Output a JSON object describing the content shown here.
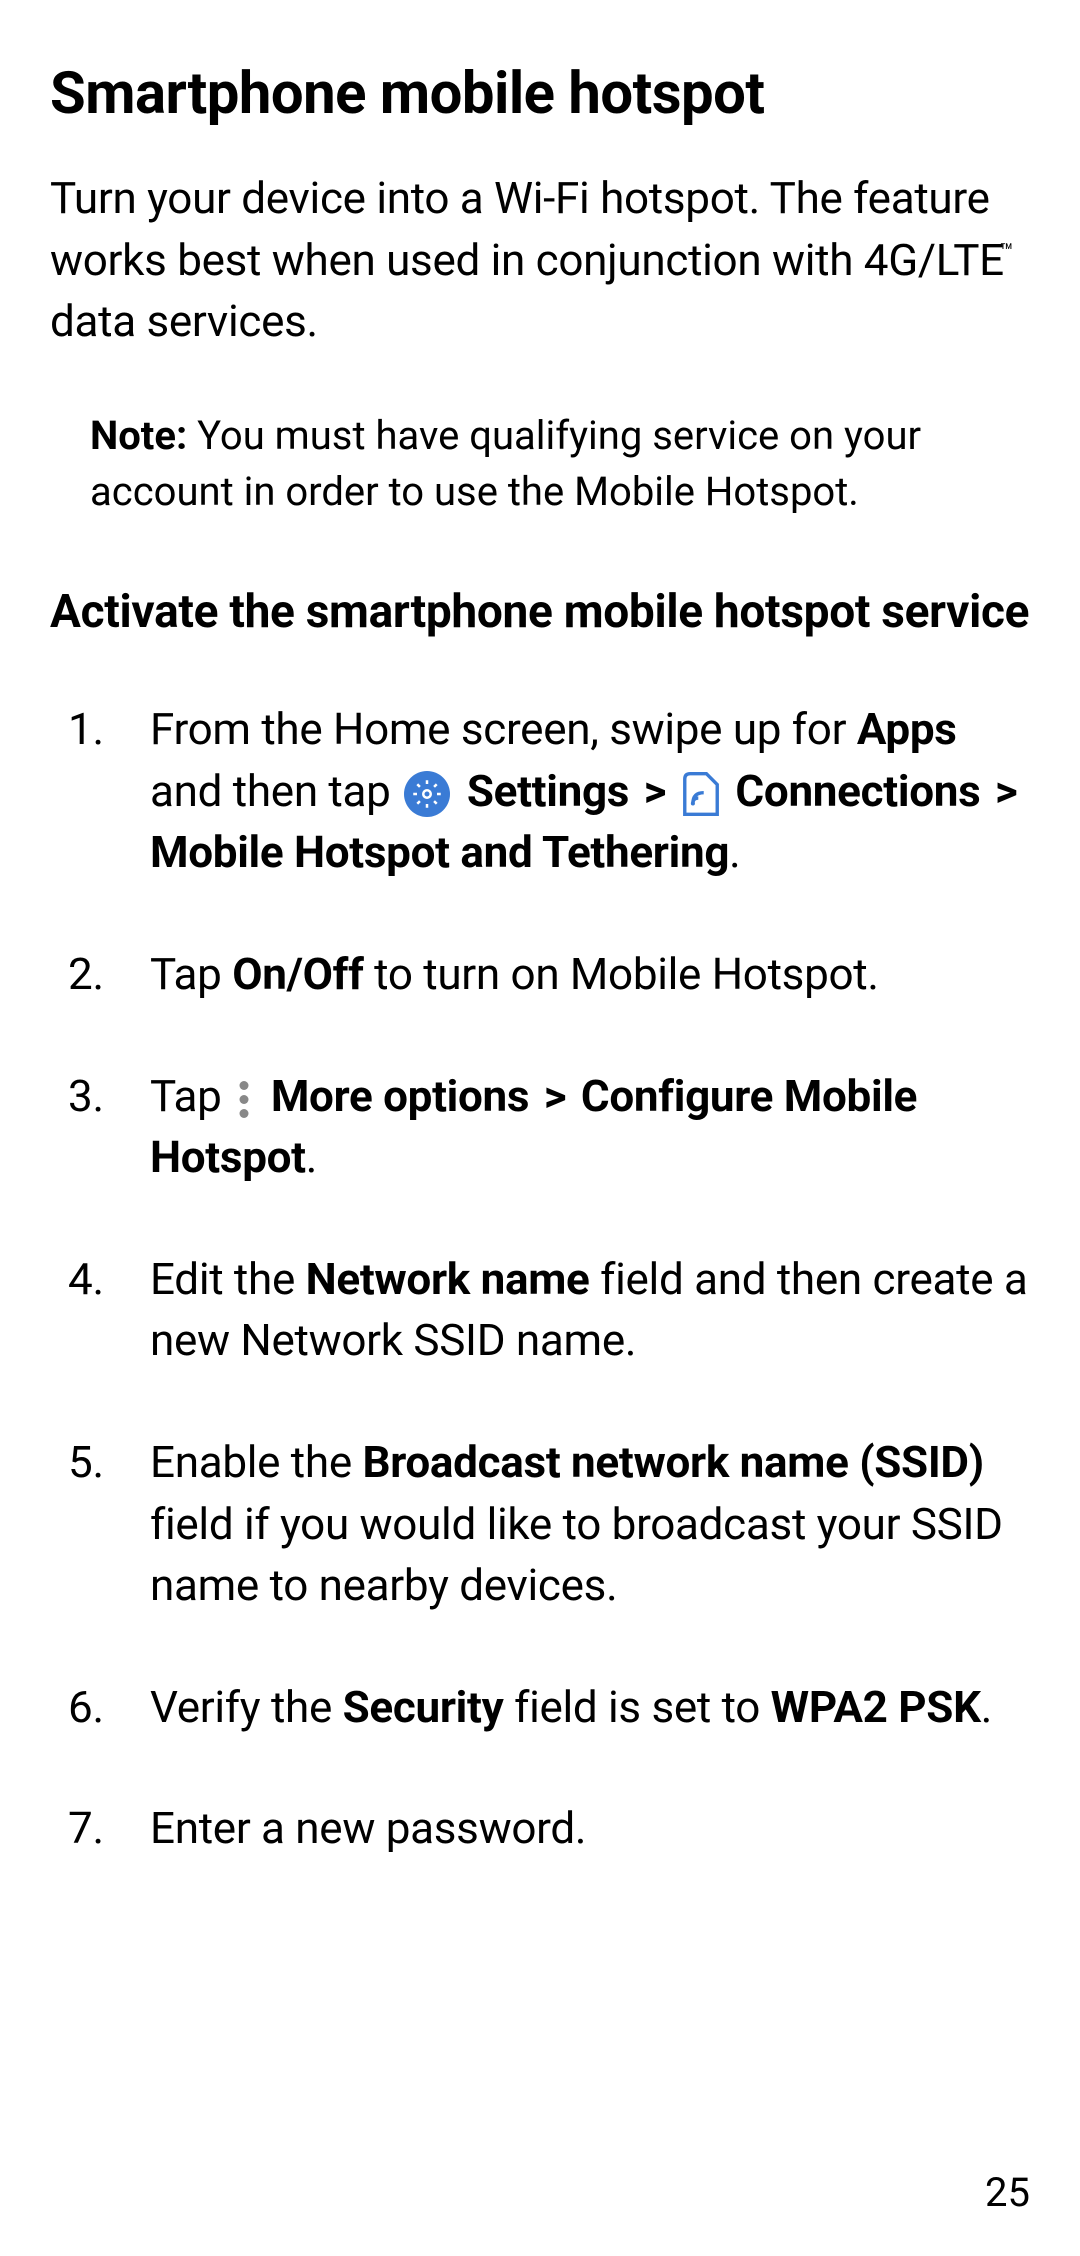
{
  "heading1": "Smartphone mobile hotspot",
  "intro": {
    "part1": "Turn your device into a Wi-Fi hotspot. The feature works best when used in conjunction with 4G/LTE",
    "tm": "™",
    "part2": " data services."
  },
  "note": {
    "label": "Note:",
    "text": " You must have qualifying service on your account in order to use the Mobile Hotspot."
  },
  "heading2": "Activate the smartphone mobile hotspot service",
  "steps": {
    "s1": {
      "t1": "From the Home screen, swipe up for ",
      "apps": "Apps",
      "t2": " and then tap ",
      "settings": " Settings",
      "connections": " Connections",
      "mobilehotspot": " Mobile Hotspot and Tethering",
      "period": "."
    },
    "s2": {
      "t1": "Tap ",
      "onoff": "On/Off",
      "t2": " to turn on Mobile Hotspot."
    },
    "s3": {
      "t1": "Tap ",
      "more": " More options",
      "configure": " Configure Mobile Hotspot",
      "period": "."
    },
    "s4": {
      "t1": "Edit the ",
      "netname": "Network name",
      "t2": " field and then create a new Network SSID name."
    },
    "s5": {
      "t1": "Enable the ",
      "broadcast": "Broadcast network name (SSID)",
      "t2": " field if you would like to broadcast your SSID name to nearby devices."
    },
    "s6": {
      "t1": "Verify the ",
      "security": "Security",
      "t2": " field is set to ",
      "wpa": "WPA2 PSK",
      "period": "."
    },
    "s7": {
      "t1": "Enter a new password."
    }
  },
  "chevron": ">",
  "page_number": "25"
}
